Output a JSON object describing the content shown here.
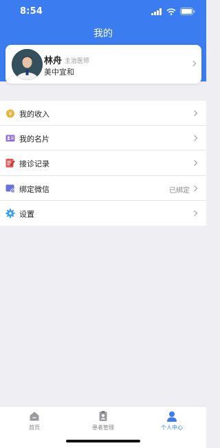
{
  "status_bar": {
    "time": "8:54"
  },
  "header": {
    "title": "我的"
  },
  "profile": {
    "name": "林舟",
    "role": "主治医师",
    "organization": "美中宜和"
  },
  "menu": {
    "items": [
      {
        "label": "我的收入",
        "value": "",
        "icon": "income-coin-icon",
        "color": "#e8b33a"
      },
      {
        "label": "我的名片",
        "value": "",
        "icon": "business-card-icon",
        "color": "#8f6ee0"
      },
      {
        "label": "接诊记录",
        "value": "",
        "icon": "consultation-record-icon",
        "color": "#e85555"
      },
      {
        "label": "绑定微信",
        "value": "已绑定",
        "icon": "bind-wechat-icon",
        "color": "#6c6fd8"
      },
      {
        "label": "设置",
        "value": "",
        "icon": "settings-gear-icon",
        "color": "#3b9ef0"
      }
    ]
  },
  "tabbar": {
    "tabs": [
      {
        "label": "首页",
        "icon": "home-icon",
        "active": false
      },
      {
        "label": "患者管理",
        "icon": "patient-management-icon",
        "active": false
      },
      {
        "label": "个人中心",
        "icon": "person-icon",
        "active": true
      }
    ]
  },
  "colors": {
    "accent": "#3b7cf0",
    "background": "#eeeef3"
  }
}
